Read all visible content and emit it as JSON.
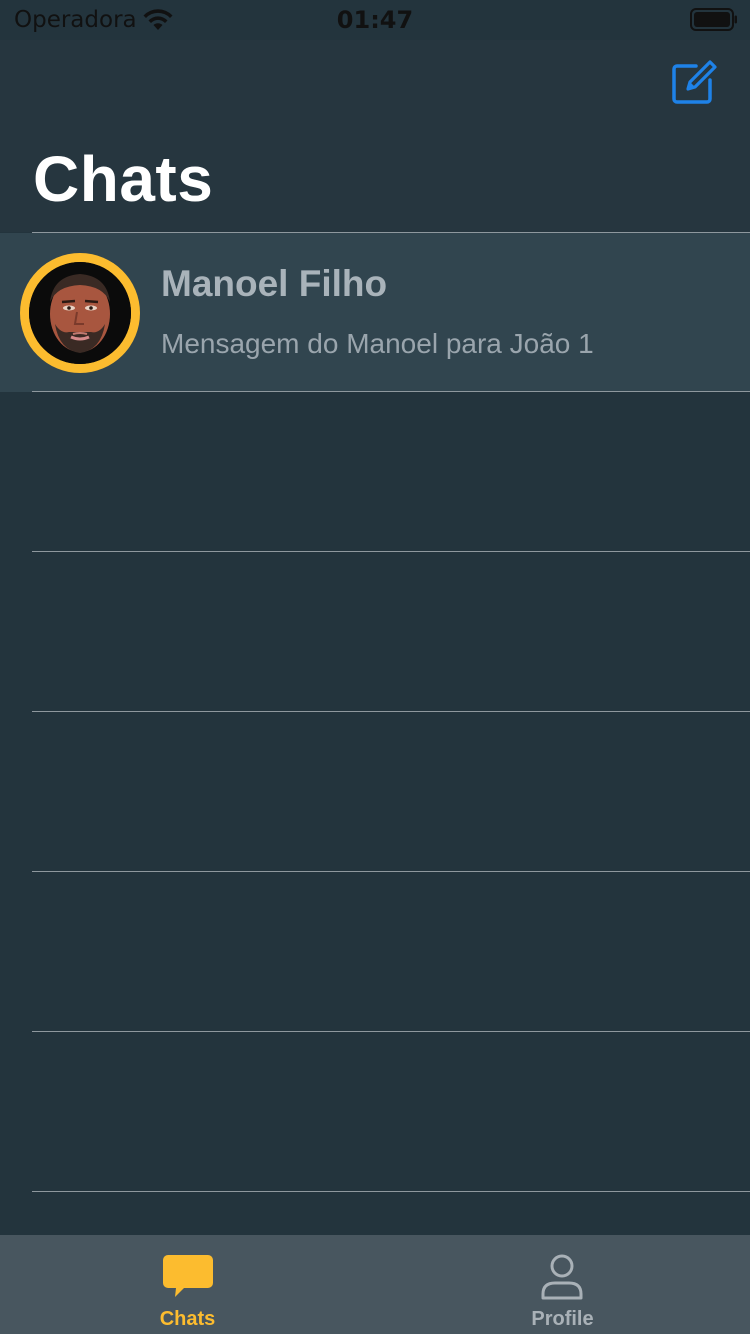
{
  "status_bar": {
    "carrier": "Operadora",
    "time": "01:47",
    "wifi_icon": "wifi-icon",
    "battery_icon": "battery-icon"
  },
  "nav": {
    "title": "Chats",
    "compose_icon": "compose-icon"
  },
  "chats": [
    {
      "name": "Manoel Filho",
      "message": "Mensagem do Manoel para João 1",
      "avatar_ring_color": "#fcbc2f"
    }
  ],
  "tabs": [
    {
      "label": "Chats",
      "icon": "chat-bubble-icon",
      "active": true
    },
    {
      "label": "Profile",
      "icon": "person-icon",
      "active": false
    }
  ],
  "colors": {
    "background": "#23343d",
    "accent": "#fcbc2f",
    "compose_blue": "#1e82e8",
    "tab_bar": "#48565f"
  }
}
